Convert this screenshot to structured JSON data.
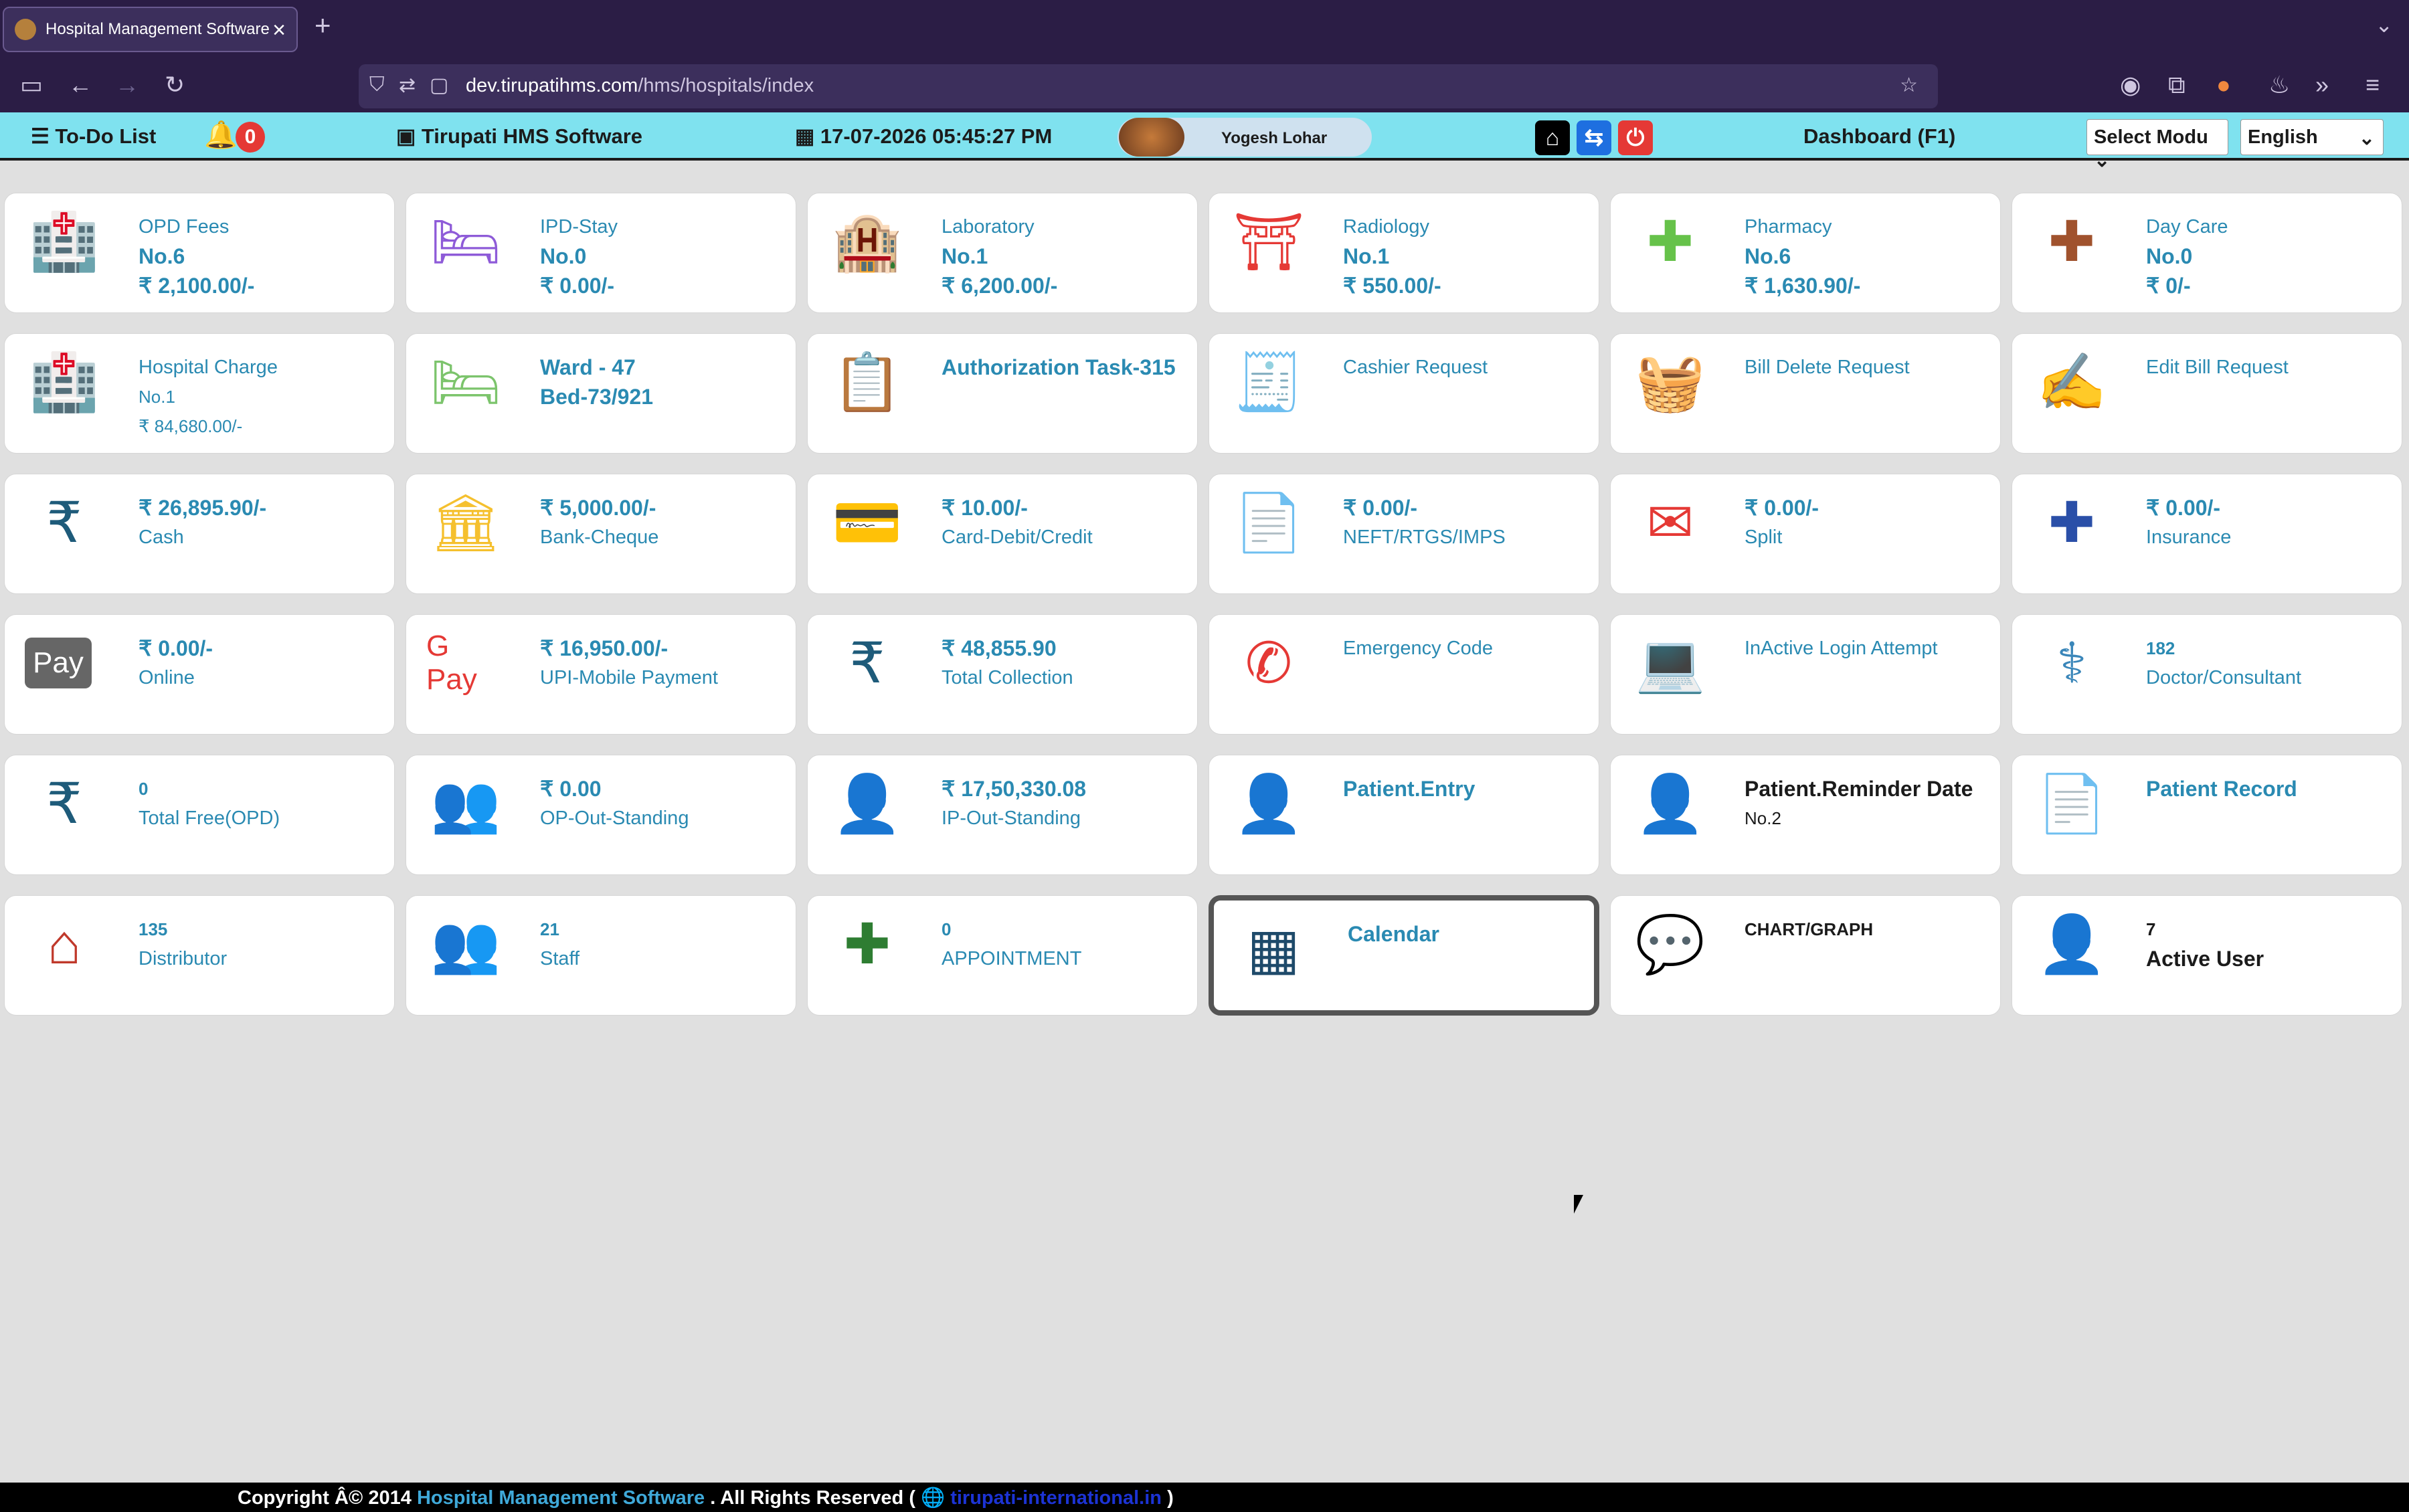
{
  "browser": {
    "tab_title": "Hospital Management Software",
    "url_host": "dev.tirupatihms.com",
    "url_path": "/hms/hospitals/index"
  },
  "header": {
    "todo_label": "To-Do List",
    "notif_count": "0",
    "brand": "Tirupati HMS Software",
    "datetime": "17-07-2026 05:45:27 PM",
    "user_name": "Yogesh Lohar",
    "dashboard_label": "Dashboard (F1)",
    "module_select": "Select Modu",
    "language_select": "English"
  },
  "cards": [
    {
      "l1": "OPD Fees",
      "l2": "No.6",
      "l3": "₹ 2,100.00/-",
      "icon": "hospital-user-icon",
      "color": "#4caf50"
    },
    {
      "l1": "IPD-Stay",
      "l2": "No.0",
      "l3": "₹ 0.00/-",
      "icon": "bed-pulse-icon",
      "color": "#8e5bd8"
    },
    {
      "l1": "Laboratory",
      "l2": "No.1",
      "l3": "₹ 6,200.00/-",
      "icon": "hospital-building-icon",
      "color": "#f5b52e"
    },
    {
      "l1": "Radiology",
      "l2": "No.1",
      "l3": "₹ 550.00/-",
      "icon": "torii-gate-icon",
      "color": "#e53935"
    },
    {
      "l1": "Pharmacy",
      "l2": "No.6",
      "l3": "₹ 1,630.90/-",
      "icon": "medical-plus-icon",
      "color": "#66c24a"
    },
    {
      "l1": "Day Care",
      "l2": "No.0",
      "l3": "₹ 0/-",
      "icon": "medkit-icon",
      "color": "#a0522d"
    },
    {
      "l1": "Hospital Charge",
      "l2": "No.1",
      "l3": "₹ 84,680.00/-",
      "icon": "hospital-icon",
      "color": "#3a86d9"
    },
    {
      "l1": "Ward - 47",
      "l2": "Bed-73/921",
      "l3": "",
      "icon": "bed-icon",
      "color": "#7cc46c"
    },
    {
      "l1": "Authorization Task-315",
      "l2": "",
      "l3": "",
      "icon": "task-board-icon",
      "color": "#333"
    },
    {
      "l1": "Cashier Request",
      "l2": "",
      "l3": "",
      "icon": "cashier-icon",
      "color": "#c0392b"
    },
    {
      "l1": "Bill Delete Request",
      "l2": "",
      "l3": "",
      "icon": "bill-basket-icon",
      "color": "#1f3b8a"
    },
    {
      "l1": "Edit Bill Request",
      "l2": "",
      "l3": "",
      "icon": "signed-cheque-icon",
      "color": "#222"
    },
    {
      "l1": "₹ 26,895.90/-",
      "l2": "Cash",
      "l3": "",
      "icon": "rupee-icon",
      "color": "#1e5b7a"
    },
    {
      "l1": "₹ 5,000.00/-",
      "l2": "Bank-Cheque",
      "l3": "",
      "icon": "bank-icon",
      "color": "#f5c02e"
    },
    {
      "l1": "₹ 10.00/-",
      "l2": "Card-Debit/Credit",
      "l3": "",
      "icon": "credit-card-icon",
      "color": "#777"
    },
    {
      "l1": "₹ 0.00/-",
      "l2": "NEFT/RTGS/IMPS",
      "l3": "",
      "icon": "document-icon",
      "color": "#b8336a"
    },
    {
      "l1": "₹ 0.00/-",
      "l2": "Split",
      "l3": "",
      "icon": "envelope-open-icon",
      "color": "#e53935"
    },
    {
      "l1": "₹ 0.00/-",
      "l2": "Insurance",
      "l3": "",
      "icon": "medical-briefcase-icon",
      "color": "#2a4fa8"
    },
    {
      "l1": "₹ 0.00/-",
      "l2": "Online",
      "l3": "",
      "icon": "apple-pay-icon",
      "color": "#555"
    },
    {
      "l1": "₹ 16,950.00/-",
      "l2": "UPI-Mobile Payment",
      "l3": "",
      "icon": "google-pay-icon",
      "color": "#e53935"
    },
    {
      "l1": "₹ 48,855.90",
      "l2": "Total Collection",
      "l3": "",
      "icon": "rupee-icon",
      "color": "#1e5b7a"
    },
    {
      "l1": "Emergency Code",
      "l2": "",
      "l3": "",
      "icon": "phone-icon",
      "color": "#e53935"
    },
    {
      "l1": "InActive Login Attempt",
      "l2": "",
      "l3": "",
      "icon": "laptop-icon",
      "color": "#666"
    },
    {
      "l1": "182",
      "l2": "Doctor/Consultant",
      "l3": "",
      "icon": "doctor-icon",
      "color": "#3a86b9"
    },
    {
      "l1": "0",
      "l2": "Total Free(OPD)",
      "l3": "",
      "icon": "rupee-icon",
      "color": "#1e5b7a"
    },
    {
      "l1": "₹ 0.00",
      "l2": "OP-Out-Standing",
      "l3": "",
      "icon": "user-group-icon",
      "color": "#6a5ad8"
    },
    {
      "l1": "₹ 17,50,330.08",
      "l2": "IP-Out-Standing",
      "l3": "",
      "icon": "user-icon",
      "color": "#f5b52e"
    },
    {
      "l1": "Patient.Entry",
      "l2": "",
      "l3": "",
      "icon": "presenter-icon",
      "color": "#8b1a5e"
    },
    {
      "l1": "Patient.Reminder Date",
      "l2": "No.2",
      "l3": "",
      "icon": "presenter-icon",
      "color": "#8b1a5e"
    },
    {
      "l1": "Patient Record",
      "l2": "",
      "l3": "",
      "icon": "file-medical-icon",
      "color": "#4caf50"
    },
    {
      "l1": "135",
      "l2": "Distributor",
      "l3": "",
      "icon": "house-medical-icon",
      "color": "#c0392b"
    },
    {
      "l1": "21",
      "l2": "Staff",
      "l3": "",
      "icon": "users-icon",
      "color": "#1e5b7a"
    },
    {
      "l1": "0",
      "l2": "APPOINTMENT",
      "l3": "",
      "icon": "hand-holding-medical-icon",
      "color": "#2e7d32"
    },
    {
      "l1": "Calendar",
      "l2": "",
      "l3": "",
      "icon": "calendar-icon",
      "color": "#1e4a6a"
    },
    {
      "l1": "CHART/GRAPH",
      "l2": "",
      "l3": "",
      "icon": "comment-dots-icon",
      "color": "#3a9ad9"
    },
    {
      "l1": "7",
      "l2": "Active User",
      "l3": "",
      "icon": "user-icon",
      "color": "#f5b52e"
    }
  ],
  "footer": {
    "prefix": "Copyright Â© 2014",
    "app": "Hospital Management Software",
    "rights": ". All Rights Reserved (",
    "link": "tirupati-international.in",
    "suffix": ")"
  }
}
